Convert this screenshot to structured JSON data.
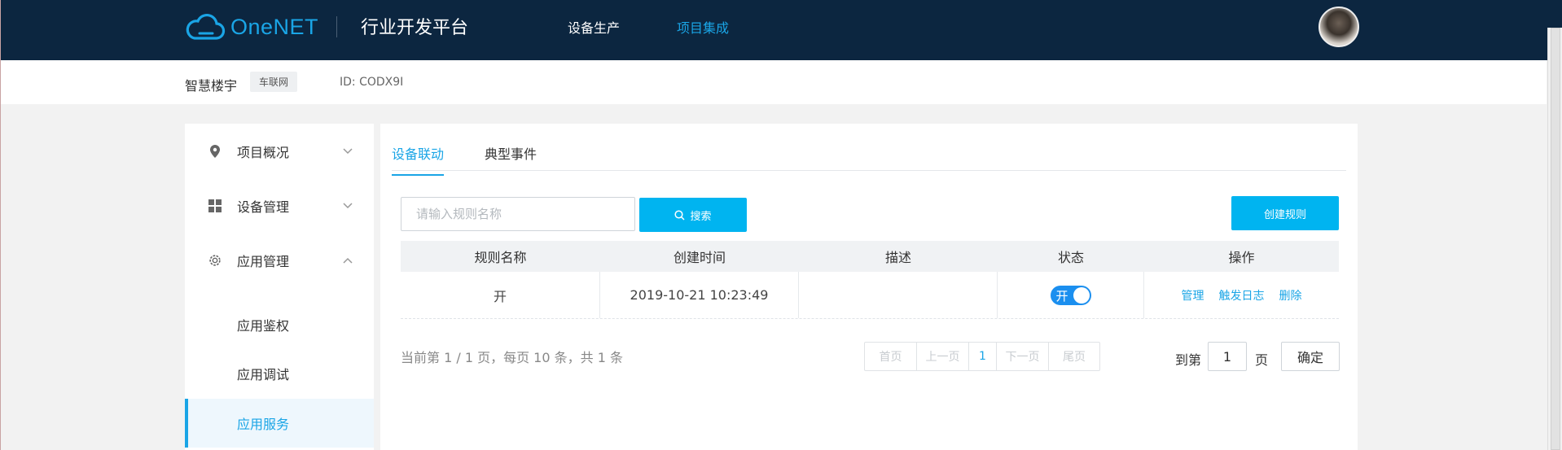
{
  "header": {
    "logo_text": "OneNET",
    "platform_title": "行业开发平台",
    "nav": [
      {
        "label": "设备生产",
        "active": false
      },
      {
        "label": "项目集成",
        "active": true
      }
    ],
    "accent_color": "#1aa5e6",
    "bg_color": "#0c2640"
  },
  "project": {
    "name": "智慧楼宇",
    "tag": "车联网",
    "id_text": "ID: CODX9I"
  },
  "sidebar": {
    "items": [
      {
        "label": "项目概况",
        "icon": "location-pin-icon",
        "expanded": false
      },
      {
        "label": "设备管理",
        "icon": "grid-icon",
        "expanded": false
      },
      {
        "label": "应用管理",
        "icon": "gear-icon",
        "expanded": true
      }
    ],
    "sub_items": [
      {
        "label": "应用鉴权",
        "active": false
      },
      {
        "label": "应用调试",
        "active": false
      },
      {
        "label": "应用服务",
        "active": true
      }
    ]
  },
  "tabs": [
    {
      "label": "设备联动",
      "active": true
    },
    {
      "label": "典型事件",
      "active": false
    }
  ],
  "search": {
    "placeholder": "请输入规则名称",
    "button_label": "搜索"
  },
  "create_button_label": "创建规则",
  "table": {
    "columns": [
      "规则名称",
      "创建时间",
      "描述",
      "状态",
      "操作"
    ],
    "rows": [
      {
        "name": "开",
        "created": "2019-10-21 10:23:49",
        "description": "",
        "status_label": "开",
        "status_on": true,
        "actions": [
          "管理",
          "触发日志",
          "删除"
        ]
      }
    ]
  },
  "pagination": {
    "info": "当前第 1 / 1 页，每页 10 条，共 1 条",
    "first": "首页",
    "prev": "上一页",
    "current": "1",
    "next": "下一页",
    "last": "尾页",
    "goto_prefix": "到第",
    "goto_value": "1",
    "goto_suffix": "页",
    "confirm": "确定"
  }
}
